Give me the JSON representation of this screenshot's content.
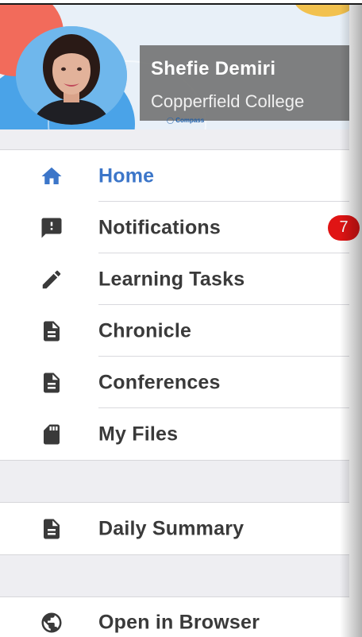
{
  "header": {
    "user_name": "Shefie Demiri",
    "school": "Copperfield College",
    "brand": "Compass"
  },
  "menu": {
    "home": "Home",
    "notifications": "Notifications",
    "notifications_badge": "7",
    "learning_tasks": "Learning Tasks",
    "chronicle": "Chronicle",
    "conferences": "Conferences",
    "my_files": "My Files",
    "daily_summary": "Daily Summary",
    "open_in_browser": "Open in Browser"
  },
  "colors": {
    "accent": "#3c76c9",
    "badge": "#e01414",
    "text": "#3a3a3a",
    "separator_band": "#eeeef2"
  },
  "icons": {
    "home": "home-icon",
    "notifications": "feedback-icon",
    "learning_tasks": "pencil-icon",
    "chronicle": "document-icon",
    "conferences": "document-icon",
    "my_files": "sd-card-icon",
    "daily_summary": "document-icon",
    "open_in_browser": "globe-icon"
  }
}
